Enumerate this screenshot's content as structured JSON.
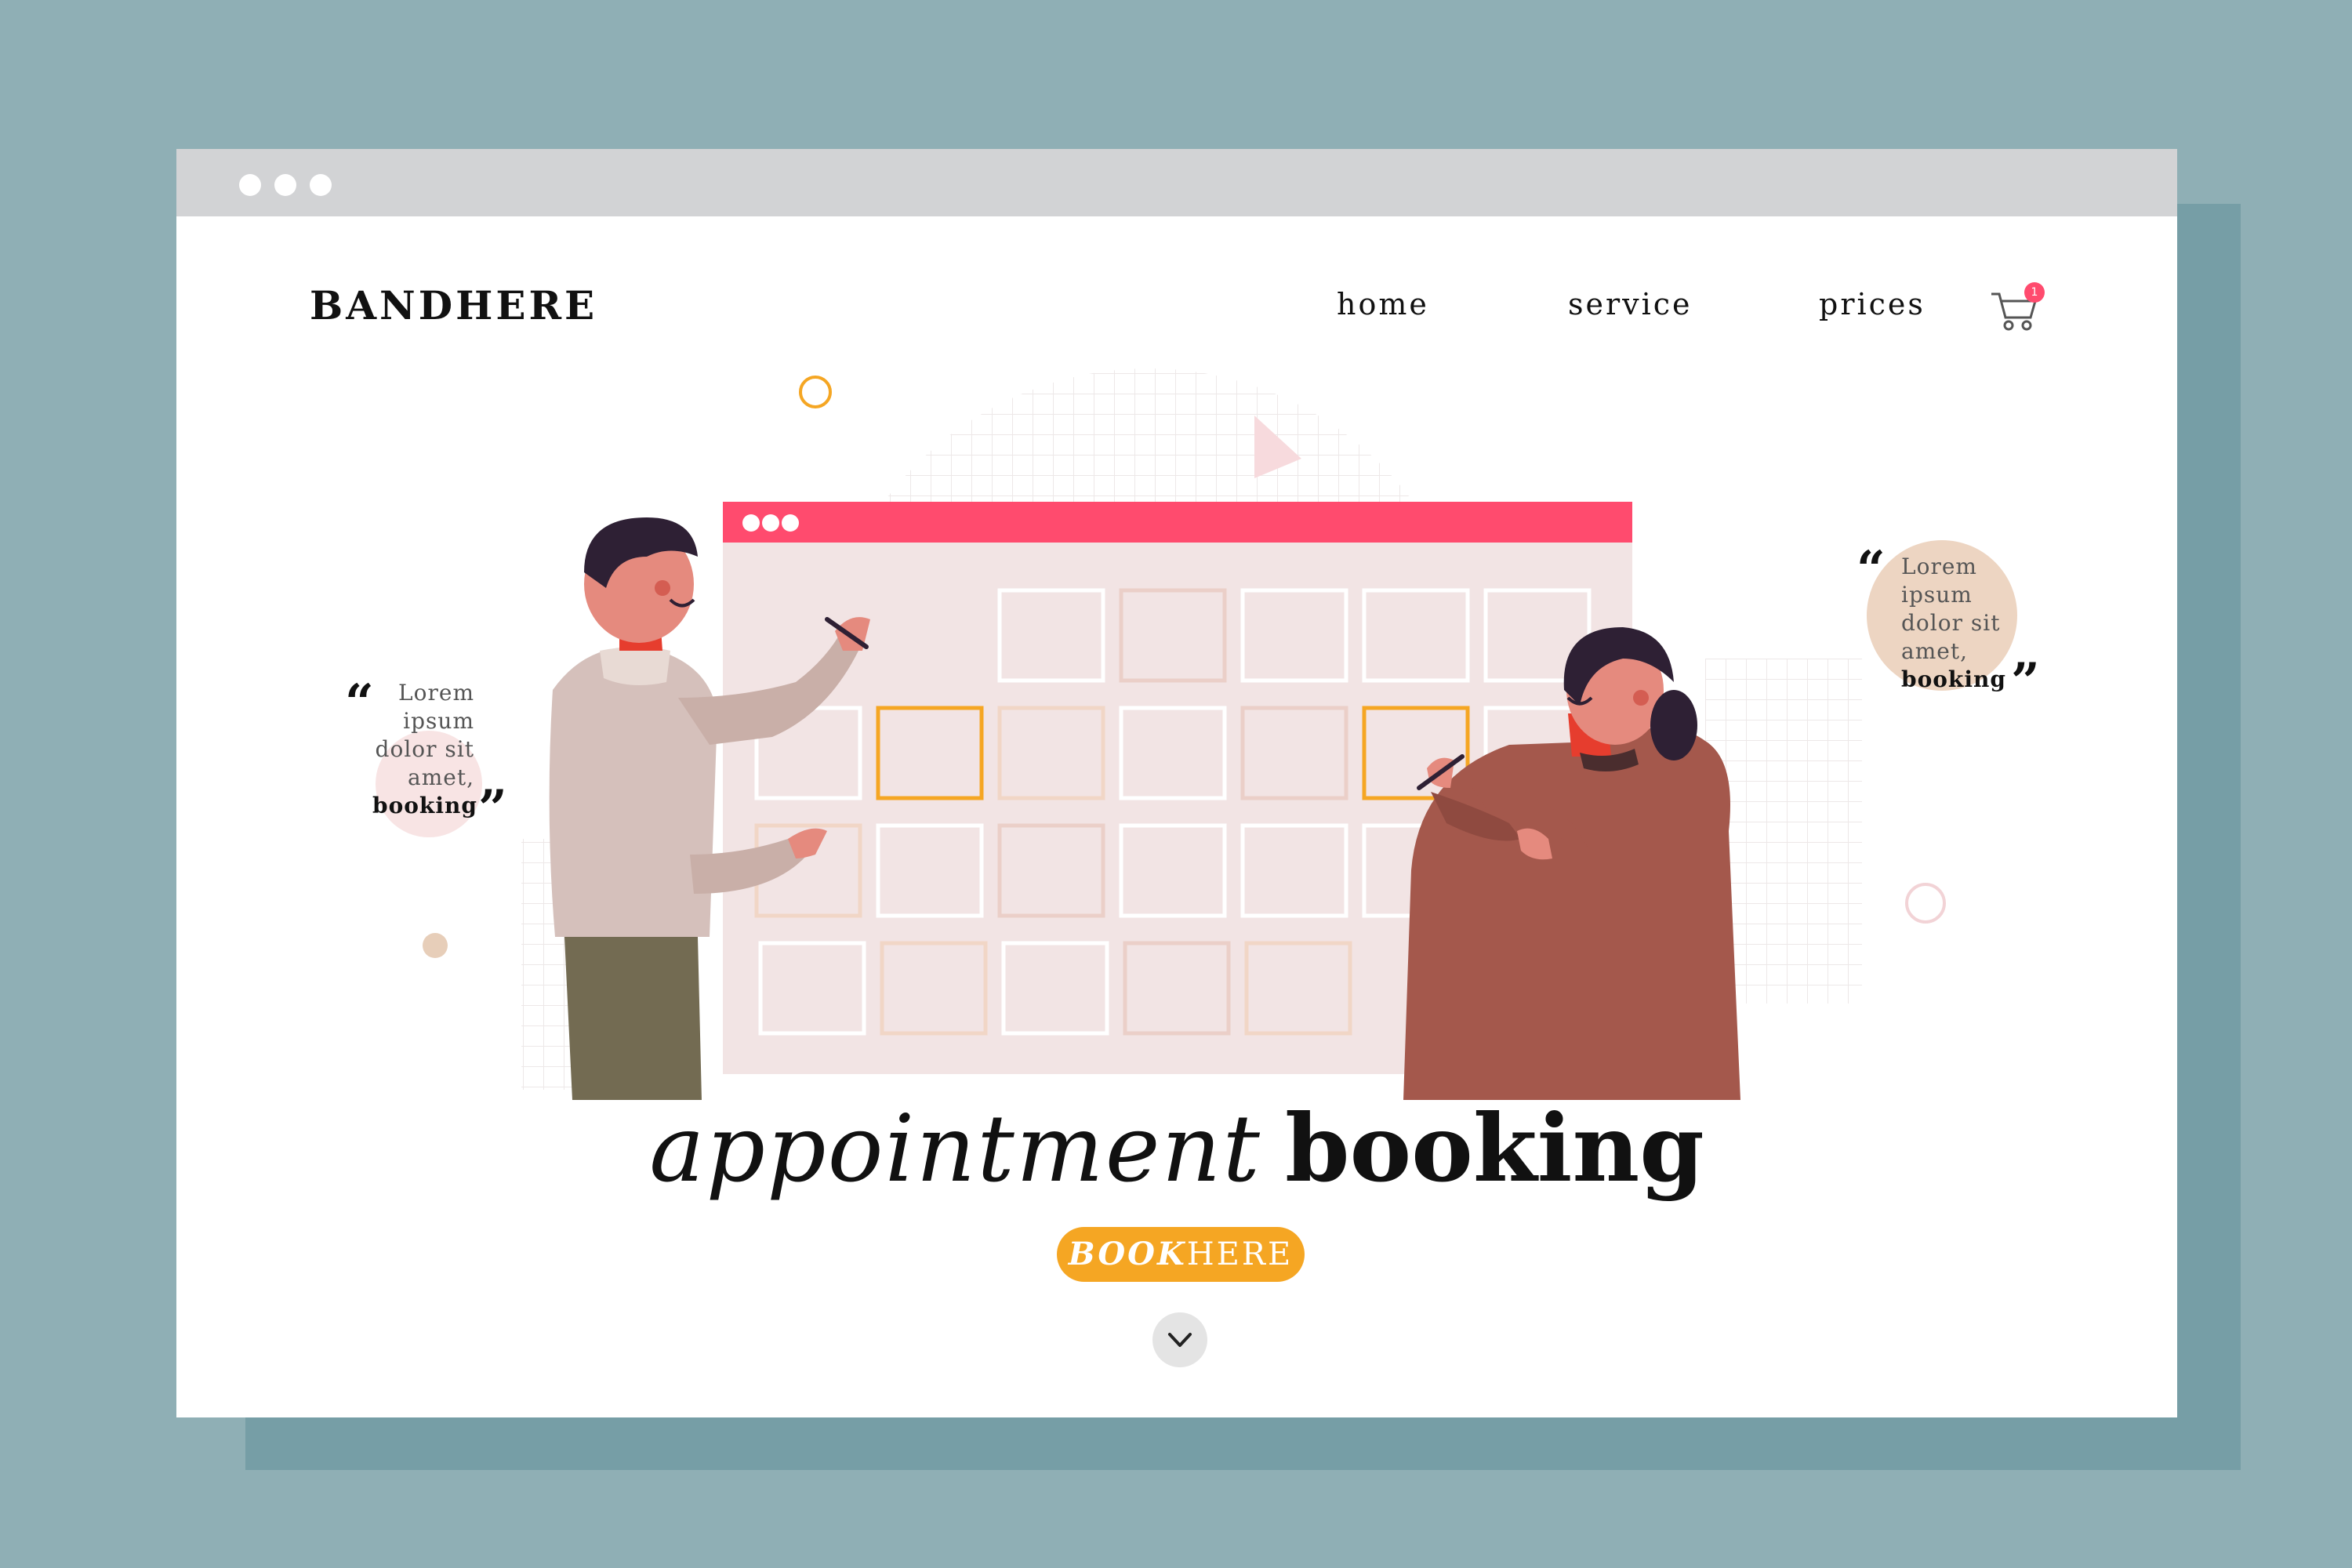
{
  "header": {
    "logo": "BANDHERE",
    "nav": [
      {
        "label": "home"
      },
      {
        "label": "service"
      },
      {
        "label": "prices"
      }
    ],
    "cart_count": "1"
  },
  "quotes": {
    "left": {
      "lines": [
        "Lorem",
        "ipsum",
        "dolor sit",
        "amet,"
      ],
      "bold": "booking"
    },
    "right": {
      "lines": [
        "Lorem",
        "ipsum",
        "dolor sit",
        "amet,"
      ],
      "bold": "booking"
    }
  },
  "hero": {
    "headline_light": "appointment",
    "headline_bold": "booking",
    "cta_bold": "BOOK",
    "cta_rest": "HERE"
  },
  "icons": {
    "cart": "shopping-cart-icon",
    "scroll": "chevron-down-icon",
    "quote_open": "open-quote-icon",
    "quote_close": "close-quote-icon"
  },
  "colors": {
    "background": "#8FAFB5",
    "shadow_panel": "#769EA6",
    "titlebar": "#D2D3D5",
    "accent_pink": "#FF4B6E",
    "accent_orange": "#F5A623",
    "calendar_bg": "#F2E4E4"
  }
}
